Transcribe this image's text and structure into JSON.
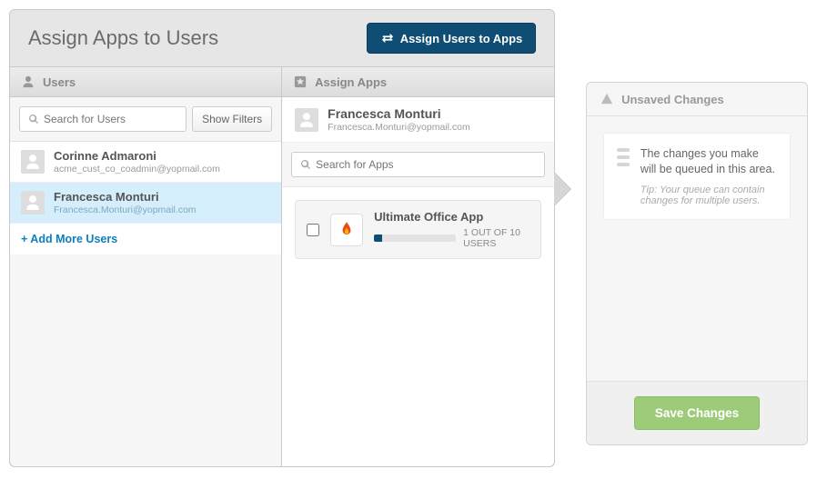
{
  "header": {
    "title": "Assign Apps to Users",
    "switch_button": "Assign Users to Apps"
  },
  "users_panel": {
    "title": "Users",
    "search_placeholder": "Search for Users",
    "show_filters_label": "Show Filters",
    "add_more_label": "+ Add More Users",
    "users": [
      {
        "name": "Corinne Admaroni",
        "email": "acme_cust_co_coadmin@yopmail.com",
        "selected": false
      },
      {
        "name": "Francesca Monturi",
        "email": "Francesca.Monturi@yopmail.com",
        "selected": true
      }
    ]
  },
  "apps_panel": {
    "title": "Assign Apps",
    "selected_user": {
      "name": "Francesca Monturi",
      "email": "Francesca.Monturi@yopmail.com"
    },
    "search_placeholder": "Search for Apps",
    "apps": [
      {
        "name": "Ultimate Office App",
        "usage_label": "1 OUT OF 10 USERS",
        "usage_fraction": 0.1
      }
    ]
  },
  "side": {
    "title": "Unsaved Changes",
    "message": "The changes you make will be queued in this area.",
    "tip": "Tip: Your queue can contain changes for multiple users.",
    "save_label": "Save Changes"
  }
}
